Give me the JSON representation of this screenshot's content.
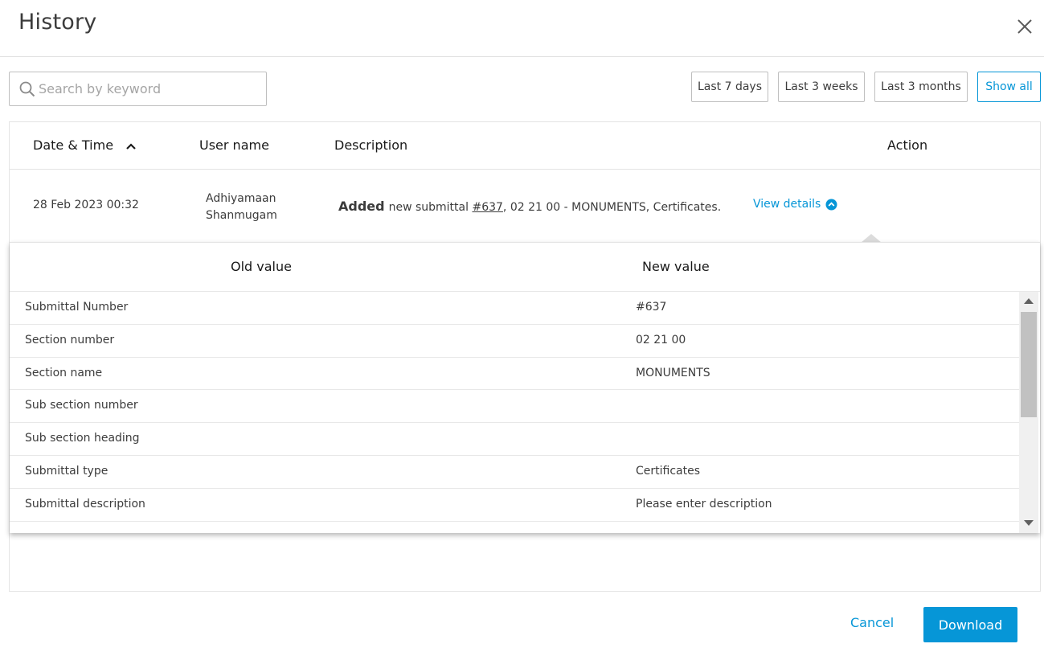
{
  "dialog": {
    "title": "History"
  },
  "search": {
    "placeholder": "Search by keyword",
    "value": ""
  },
  "filters": [
    {
      "label": "Last 7 days",
      "active": false
    },
    {
      "label": "Last 3 weeks",
      "active": false
    },
    {
      "label": "Last 3 months",
      "active": false
    },
    {
      "label": "Show all",
      "active": true
    }
  ],
  "table": {
    "columns": {
      "date": "Date & Time",
      "user": "User name",
      "description": "Description",
      "action": "Action"
    },
    "sort": {
      "column": "date",
      "direction": "ascending"
    },
    "rows": [
      {
        "date": "28 Feb 2023 00:32",
        "user_first": "Adhiyamaan",
        "user_last": "Shanmugam",
        "verb": "Added",
        "desc_prefix": "new submittal ",
        "desc_link": "#637",
        "desc_suffix": ", 02 21 00 - MONUMENTS, Certificates.",
        "action_label": "View details"
      }
    ]
  },
  "details": {
    "old_header": "Old value",
    "new_header": "New value",
    "rows": [
      {
        "label": "Submittal Number",
        "old": "",
        "new": "#637"
      },
      {
        "label": "Section number",
        "old": "",
        "new": "02 21 00"
      },
      {
        "label": "Section name",
        "old": "",
        "new": "MONUMENTS"
      },
      {
        "label": "Sub section number",
        "old": "",
        "new": ""
      },
      {
        "label": "Sub section heading",
        "old": "",
        "new": ""
      },
      {
        "label": "Submittal type",
        "old": "",
        "new": "Certificates"
      },
      {
        "label": "Submittal description",
        "old": "",
        "new": "Please enter description"
      }
    ]
  },
  "footer": {
    "cancel_label": "Cancel",
    "download_label": "Download"
  },
  "colors": {
    "accent": "#0696d7",
    "border": "#bfbfbf",
    "text": "#3c3c3c"
  }
}
